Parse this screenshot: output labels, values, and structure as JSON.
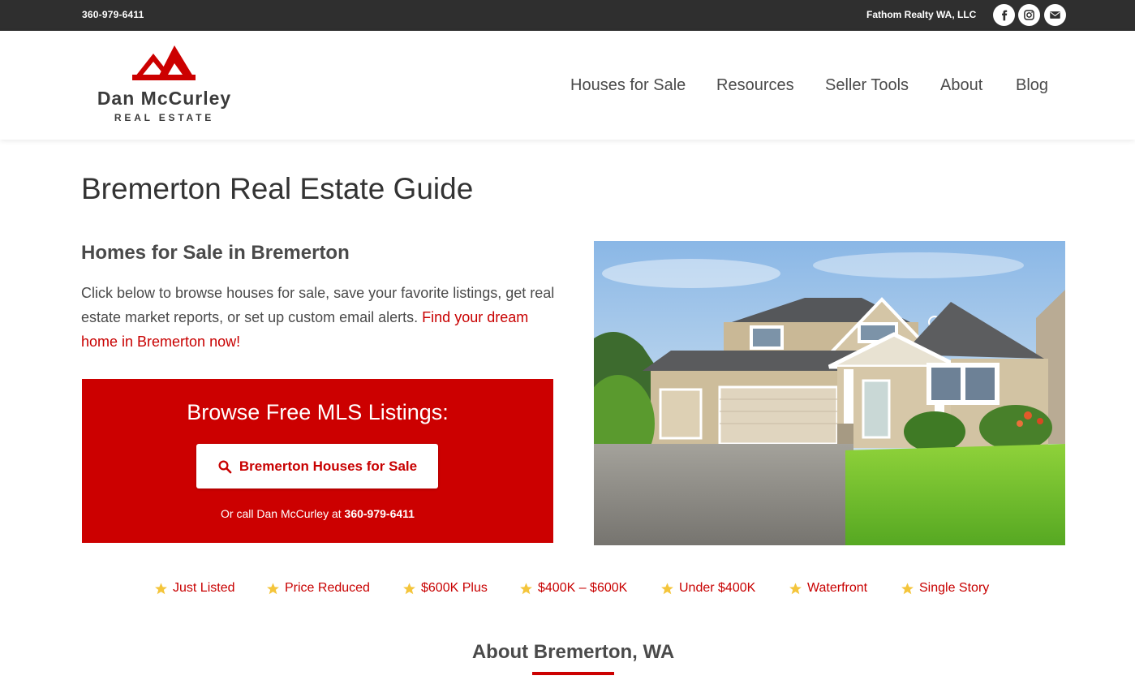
{
  "topbar": {
    "phone": "360-979-6411",
    "company": "Fathom Realty WA, LLC",
    "social_icons": [
      "facebook-icon",
      "instagram-icon",
      "email-icon"
    ]
  },
  "logo": {
    "name": "Dan McCurley",
    "subtitle": "REAL ESTATE",
    "accent_color": "#cc0000"
  },
  "nav": {
    "items": [
      "Houses for Sale",
      "Resources",
      "Seller Tools",
      "About",
      "Blog"
    ]
  },
  "main": {
    "title": "Bremerton Real Estate Guide",
    "section_heading": "Homes for Sale in Bremerton",
    "intro_text": "Click below to browse houses for sale, save your favorite listings, get real estate market reports, or set up custom email alerts. ",
    "intro_link": "Find your dream home in Bremerton now!"
  },
  "cta": {
    "title": "Browse Free MLS Listings:",
    "button_label": "Bremerton Houses for Sale",
    "call_prefix": "Or call Dan McCurley at ",
    "call_phone": "360-979-6411",
    "background_color": "#cc0000"
  },
  "quick_links": [
    "Just Listed",
    "Price Reduced",
    "$600K Plus",
    "$400K – $600K",
    "Under $400K",
    "Waterfront",
    "Single Story"
  ],
  "about": {
    "heading": "About Bremerton, WA"
  }
}
